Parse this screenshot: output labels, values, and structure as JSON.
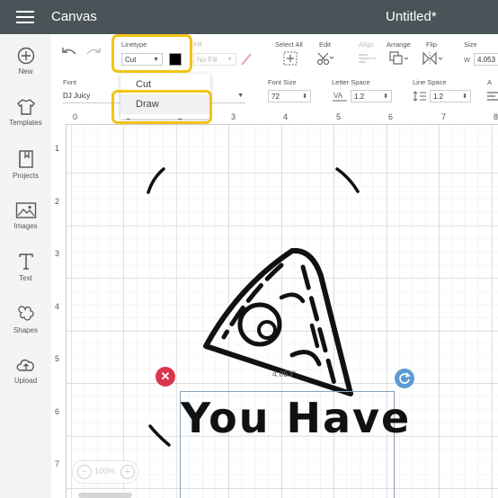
{
  "app": {
    "name": "Canvas",
    "document_title": "Untitled*"
  },
  "sidebar": {
    "items": [
      {
        "label": "New",
        "icon": "plus-circle-icon"
      },
      {
        "label": "Templates",
        "icon": "shirt-icon"
      },
      {
        "label": "Projects",
        "icon": "bookmark-book-icon"
      },
      {
        "label": "Images",
        "icon": "image-icon"
      },
      {
        "label": "Text",
        "icon": "text-T-icon"
      },
      {
        "label": "Shapes",
        "icon": "shapes-icon"
      },
      {
        "label": "Upload",
        "icon": "cloud-upload-icon"
      }
    ]
  },
  "toolbar": {
    "linetype_label": "Linetype",
    "linetype_value": "Cut",
    "linetype_color": "#000000",
    "fill_label": "Fill",
    "fill_value": "No Fill",
    "select_all_label": "Select All",
    "edit_label": "Edit",
    "align_label": "Align",
    "arrange_label": "Arrange",
    "flip_label": "Flip",
    "size_label": "Size",
    "size_w_label": "W",
    "size_w_value": "4.053"
  },
  "linetype_dropdown": {
    "options": [
      "Cut",
      "Draw"
    ],
    "selected": "Cut"
  },
  "fontbar": {
    "font_label": "Font",
    "font_value": "DJ Juicy",
    "font_size_label": "Font Size",
    "font_size_value": "72",
    "letter_space_label": "Letter Space",
    "letter_space_value": "1.2",
    "line_space_label": "Line Space",
    "line_space_value": "1.2",
    "alignment_label": "A"
  },
  "canvas": {
    "ruler_top": [
      "0",
      "1",
      "2",
      "3",
      "4",
      "5",
      "6",
      "7",
      "8"
    ],
    "ruler_left": [
      "1",
      "2",
      "3",
      "4",
      "5",
      "6",
      "7"
    ],
    "text_object": "You Have",
    "width_indicator": "4.053\"",
    "zoom_level": "100%"
  },
  "colors": {
    "appbar": "#4a5458",
    "highlight": "#f2c414",
    "delete_handle": "#d9364c",
    "rotate_handle": "#5b9bd5"
  }
}
